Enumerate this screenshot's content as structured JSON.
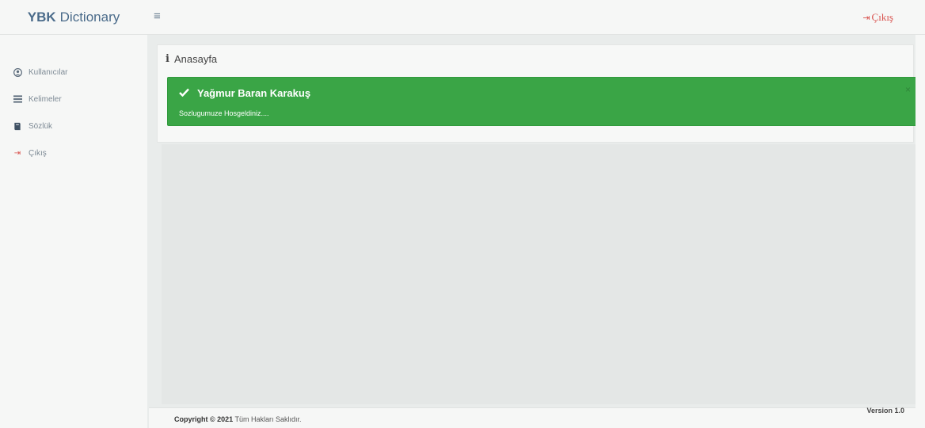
{
  "brand": {
    "bold": "YBK",
    "rest": "Dictionary"
  },
  "header": {
    "menu_icon": "hamburger-icon",
    "logout_label": "Çıkış",
    "logout_icon": "sign-out-icon"
  },
  "sidebar": {
    "items": [
      {
        "label": "Kullanıcılar",
        "icon": "user-circle-icon"
      },
      {
        "label": "Kelimeler",
        "icon": "list-icon"
      },
      {
        "label": "Sözlük",
        "icon": "book-icon"
      },
      {
        "label": "Çıkış",
        "icon": "sign-out-icon"
      }
    ]
  },
  "main": {
    "panel_title": "Anasayfa",
    "alert": {
      "title": "Yağmur Baran Karakuş",
      "message": "Sozlugumuze Hosgeldiniz....",
      "close": "×"
    }
  },
  "footer": {
    "copyright_bold": "Copyright © 2021",
    "copyright_rest": "Tüm Hakları Saklıdır.",
    "version": "Version 1.0"
  },
  "colors": {
    "accent_green": "#3aa546",
    "logout_red": "#d9534f",
    "brand_blue": "#4a6b8a"
  }
}
